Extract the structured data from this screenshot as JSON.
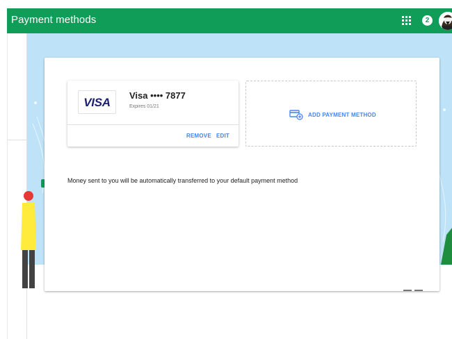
{
  "appbar": {
    "title": "Payment methods",
    "notification_count": "2",
    "apps_icon": "apps-grid-icon",
    "avatar_icon": "profile-avatar"
  },
  "payment_methods": [
    {
      "brand": "VISA",
      "name": "Visa •••• 7877",
      "expiry": "Expires 01/21",
      "remove_label": "REMOVE",
      "edit_label": "EDIT"
    }
  ],
  "add_method": {
    "label": "ADD PAYMENT METHOD",
    "icon": "add-card-icon"
  },
  "note": "Money sent to you will be automatically transferred to your default payment method",
  "colors": {
    "appbar": "#0f9d58",
    "accent": "#4285f4",
    "banner": "#bee3f8",
    "visa_blue": "#1a1f71"
  }
}
